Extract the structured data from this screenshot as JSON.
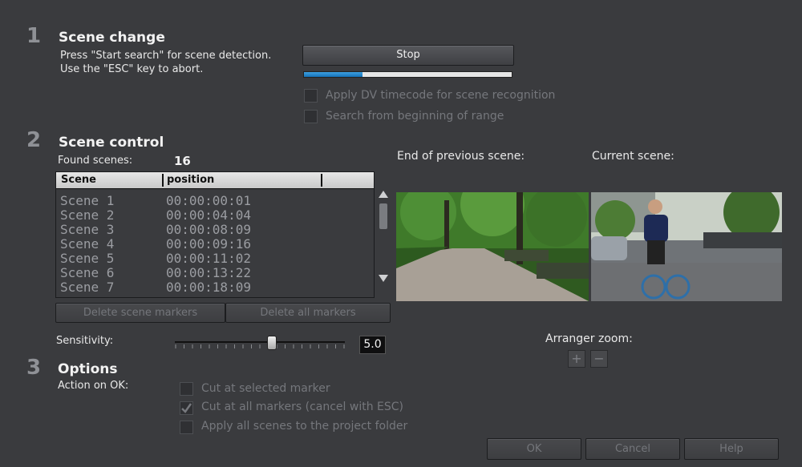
{
  "sections": {
    "s1": {
      "number": "1",
      "title": "Scene change",
      "help_line1": "Press \"Start search\" for scene detection.",
      "help_line2": "Use the \"ESC\" key to abort."
    },
    "s2": {
      "number": "2",
      "title": "Scene control"
    },
    "s3": {
      "number": "3",
      "title": "Options"
    }
  },
  "scene_change": {
    "stop_label": "Stop",
    "progress": 0.28,
    "option_dv": "Apply DV timecode for scene recognition",
    "option_begin": "Search from beginning of range"
  },
  "scene_control": {
    "found_label": "Found scenes:",
    "found_count": "16",
    "col_scene": "Scene",
    "col_position": "position",
    "rows": [
      {
        "scene": "Scene 1",
        "position": "00:00:00:01"
      },
      {
        "scene": "Scene 2",
        "position": "00:00:04:04"
      },
      {
        "scene": "Scene 3",
        "position": "00:00:08:09"
      },
      {
        "scene": "Scene 4",
        "position": "00:00:09:16"
      },
      {
        "scene": "Scene 5",
        "position": "00:00:11:02"
      },
      {
        "scene": "Scene 6",
        "position": "00:00:13:22"
      },
      {
        "scene": "Scene 7",
        "position": "00:00:18:09"
      }
    ],
    "delete_scene_markers": "Delete scene markers",
    "delete_all_markers": "Delete all markers",
    "end_prev_label": "End of previous scene:",
    "current_label": "Current scene:",
    "sensitivity_label": "Sensitivity:",
    "sensitivity_value": "5.0",
    "sensitivity_fraction": 0.57,
    "arranger_zoom_label": "Arranger zoom:",
    "zoom_in": "+",
    "zoom_out": "−"
  },
  "options": {
    "action_label": "Action on OK:",
    "cut_selected": "Cut at selected marker",
    "cut_all": "Cut at all markers (cancel with ESC)",
    "apply_all": "Apply all scenes to the project folder"
  },
  "footer": {
    "ok": "OK",
    "cancel": "Cancel",
    "help": "Help"
  }
}
